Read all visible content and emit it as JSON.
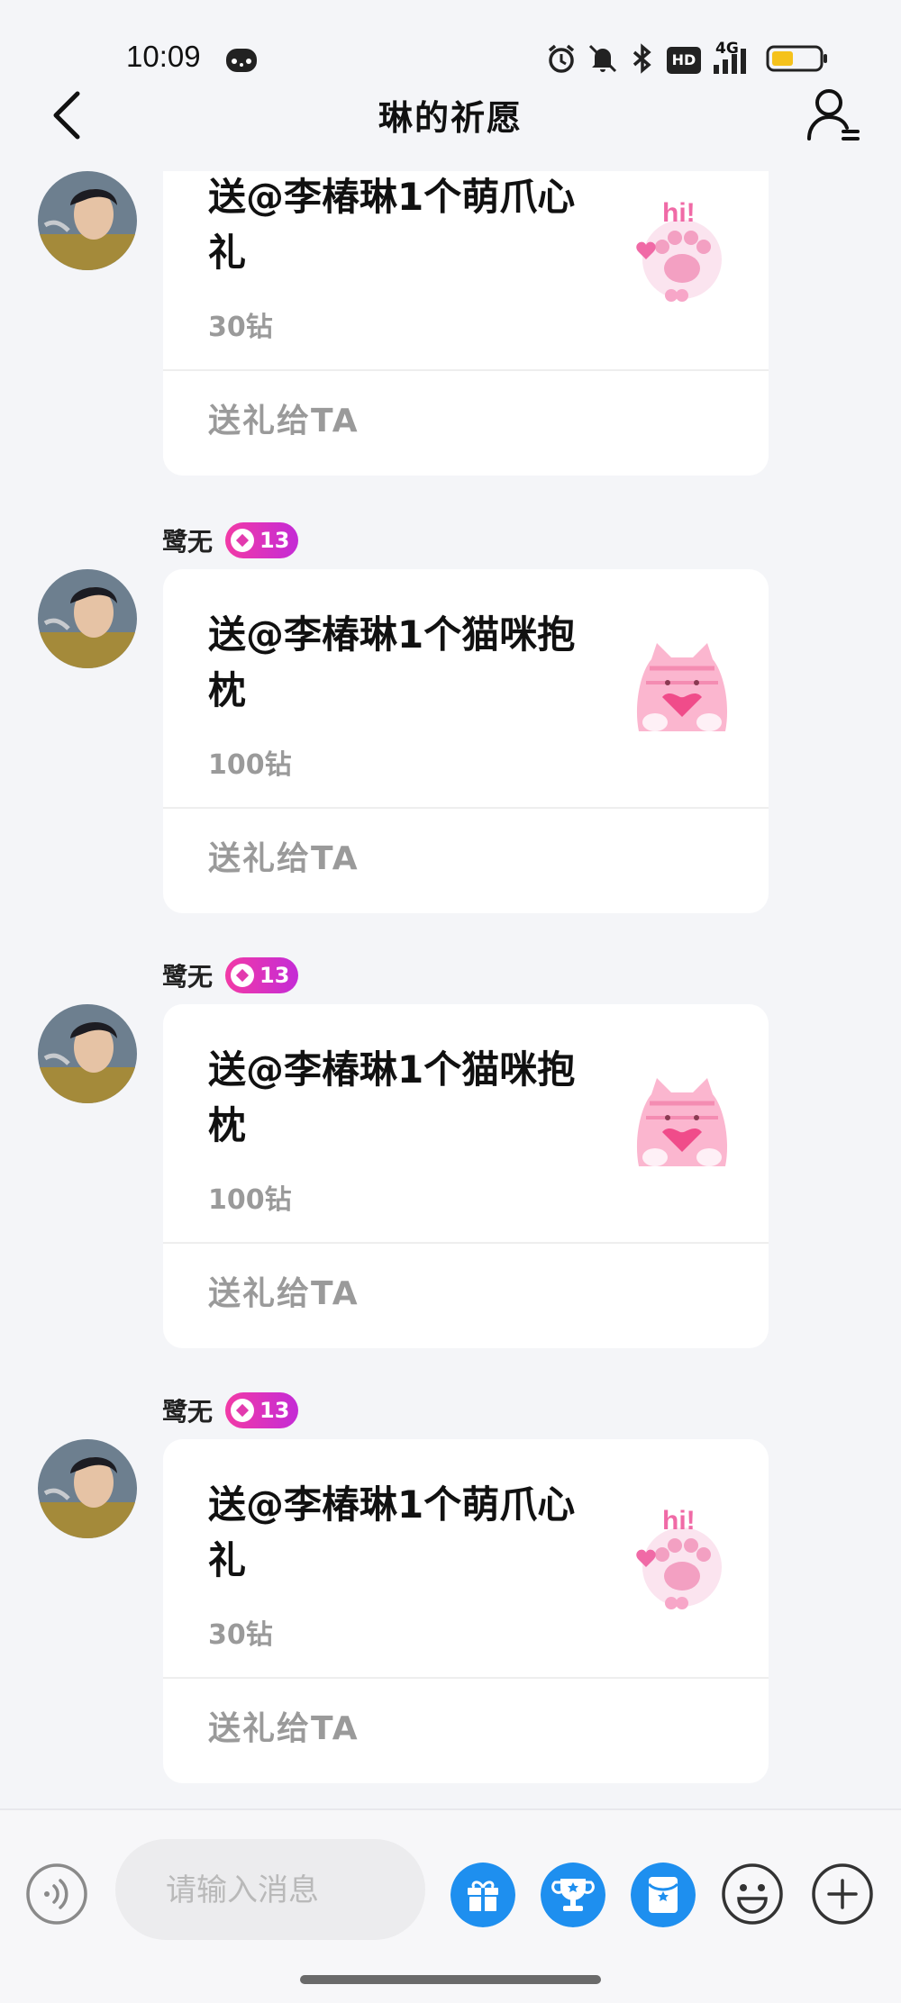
{
  "status_bar": {
    "time": "10:09",
    "battery_level": 0.45,
    "network": "4G",
    "hd_label": "HD",
    "icons": [
      "alarm-icon",
      "mute-icon",
      "bluetooth-icon",
      "hd-icon",
      "signal-icon",
      "battery-icon"
    ]
  },
  "header": {
    "title": "琳的祈愿"
  },
  "messages": [
    {
      "sender": "",
      "level": "",
      "title": "送@李椿琳1个萌爪心礼",
      "price": "30钻",
      "action": "送礼给TA",
      "gift_icon": "paw-gift-icon"
    },
    {
      "sender": "鹭无",
      "level": "13",
      "title": "送@李椿琳1个猫咪抱枕",
      "price": "100钻",
      "action": "送礼给TA",
      "gift_icon": "cat-pillow-icon"
    },
    {
      "sender": "鹭无",
      "level": "13",
      "title": "送@李椿琳1个猫咪抱枕",
      "price": "100钻",
      "action": "送礼给TA",
      "gift_icon": "cat-pillow-icon"
    },
    {
      "sender": "鹭无",
      "level": "13",
      "title": "送@李椿琳1个萌爪心礼",
      "price": "30钻",
      "action": "送礼给TA",
      "gift_icon": "paw-gift-icon"
    }
  ],
  "composer": {
    "placeholder": "请输入消息",
    "buttons": [
      "voice-icon",
      "gift-icon",
      "trophy-icon",
      "red-packet-icon",
      "emoji-icon",
      "plus-icon"
    ]
  },
  "colors": {
    "accent_blue": "#1e8fef",
    "level_badge": "#e23aae",
    "background": "#f4f5f8"
  }
}
